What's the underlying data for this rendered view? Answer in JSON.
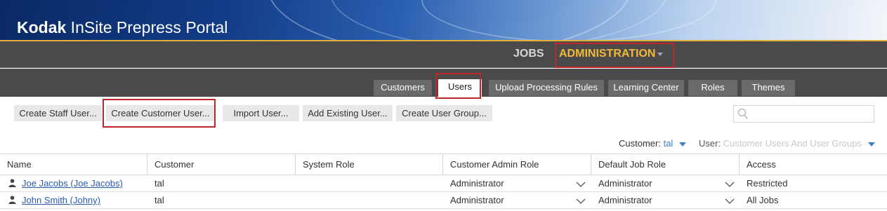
{
  "app": {
    "brand_bold": "Kodak",
    "brand_rest": " InSite Prepress Portal"
  },
  "colors": {
    "accent": "#f2b83a",
    "link": "#2a5db0",
    "highlight": "#c0262c",
    "nav_bg": "#4a4a4a"
  },
  "topnav": {
    "jobs": "JOBS",
    "administration": "ADMINISTRATION"
  },
  "tabs": [
    {
      "label": "Customers",
      "active": false
    },
    {
      "label": "Users",
      "active": true
    },
    {
      "label": "Upload Processing Rules",
      "active": false
    },
    {
      "label": "Learning Center",
      "active": false
    },
    {
      "label": "Roles",
      "active": false
    },
    {
      "label": "Themes",
      "active": false
    }
  ],
  "toolbar": {
    "buttons": [
      {
        "label": "Create Staff User..."
      },
      {
        "label": "Create Customer User..."
      },
      {
        "label": "Import User..."
      },
      {
        "label": "Add Existing User..."
      },
      {
        "label": "Create User Group..."
      }
    ],
    "search": {
      "value": "",
      "icon": "search-icon"
    }
  },
  "filters": {
    "customer_label": "Customer:",
    "customer_value": "tal",
    "user_label": "User:",
    "user_value": "Customer Users And User Groups"
  },
  "table": {
    "columns": [
      "Name",
      "Customer",
      "System Role",
      "Customer Admin Role",
      "Default Job Role",
      "Access"
    ],
    "rows": [
      {
        "name": "Joe Jacobs (Joe Jacobs)",
        "customer": "tal",
        "system_role": "",
        "customer_admin_role": "Administrator",
        "default_job_role": "Administrator",
        "access": "Restricted"
      },
      {
        "name": "John Smith (Johny)",
        "customer": "tal",
        "system_role": "",
        "customer_admin_role": "Administrator",
        "default_job_role": "Administrator",
        "access": "All Jobs"
      }
    ]
  }
}
